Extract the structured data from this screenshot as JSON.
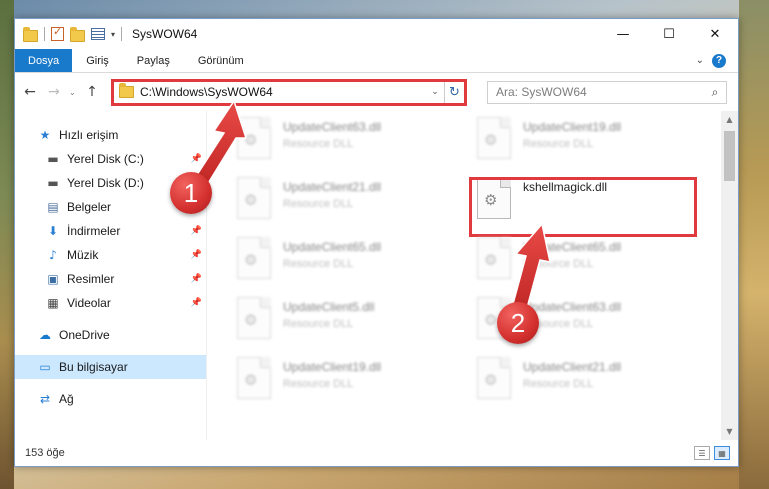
{
  "window": {
    "title": "SysWOW64",
    "controls": {
      "minimize": "—",
      "maximize": "☐",
      "close": "✕"
    }
  },
  "ribbon": {
    "tabs": [
      "Dosya",
      "Giriş",
      "Paylaş",
      "Görünüm"
    ],
    "help": "?"
  },
  "address": {
    "path": "C:\\Windows\\SysWOW64",
    "search_placeholder": "Ara: SysWOW64"
  },
  "sidebar": {
    "items": [
      {
        "label": "Hızlı erişim",
        "icon": "star-icon"
      },
      {
        "label": "Yerel Disk (C:)",
        "icon": "drive-icon",
        "pinned": true
      },
      {
        "label": "Yerel Disk (D:)",
        "icon": "drive-icon"
      },
      {
        "label": "Belgeler",
        "icon": "document-icon",
        "pinned": true
      },
      {
        "label": "İndirmeler",
        "icon": "download-icon",
        "pinned": true
      },
      {
        "label": "Müzik",
        "icon": "music-icon",
        "pinned": true
      },
      {
        "label": "Resimler",
        "icon": "pictures-icon",
        "pinned": true
      },
      {
        "label": "Videolar",
        "icon": "video-icon",
        "pinned": true
      },
      {
        "label": "OneDrive",
        "icon": "cloud-icon"
      },
      {
        "label": "Bu bilgisayar",
        "icon": "computer-icon",
        "selected": true
      },
      {
        "label": "Ağ",
        "icon": "network-icon"
      }
    ]
  },
  "files": [
    {
      "name": "UpdateClient63.dll",
      "desc": "Resource DLL"
    },
    {
      "name": "UpdateClient19.dll",
      "desc": "Resource DLL"
    },
    {
      "name": "UpdateClient21.dll",
      "desc": "Resource DLL"
    },
    {
      "name": "kshellmagick.dll",
      "desc": ""
    },
    {
      "name": "UpdateClient65.dll",
      "desc": "Resource DLL"
    },
    {
      "name": "UpdateClient65.dll",
      "desc": "Resource DLL"
    },
    {
      "name": "UpdateClient5.dll",
      "desc": "Resource DLL"
    },
    {
      "name": "UpdateClient63.dll",
      "desc": "Resource DLL"
    },
    {
      "name": "UpdateClient19.dll",
      "desc": "Resource DLL"
    },
    {
      "name": "UpdateClient21.dll",
      "desc": "Resource DLL"
    }
  ],
  "status": {
    "count": "153 öğe"
  },
  "callouts": {
    "one": "1",
    "two": "2",
    "color": "#d3302e"
  },
  "colors": {
    "file_tab": "#1979ca",
    "selection": "#cce8ff",
    "highlight": "#e0393e"
  }
}
